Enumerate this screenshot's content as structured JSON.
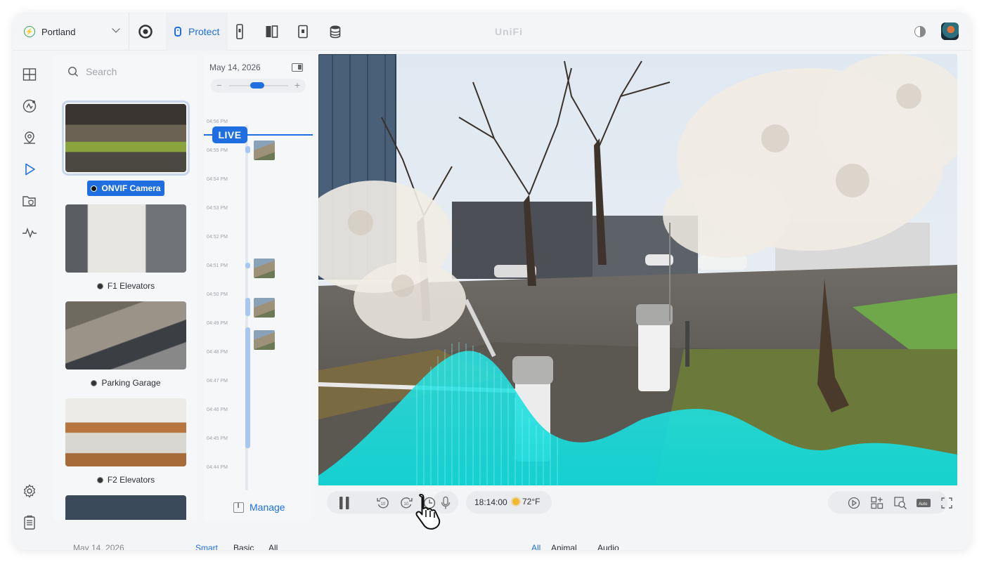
{
  "topbar": {
    "site_name": "Portland",
    "app_tab_label": "Protect",
    "brand": "UniFi",
    "apps": [
      "circle-app-icon",
      "protect-pin-icon",
      "access-device-icon",
      "panels-icon",
      "talk-device-icon",
      "storage-icon"
    ]
  },
  "nav": {
    "items": [
      "grid-view-icon",
      "ai-detect-icon",
      "map-pin-icon",
      "play-icon",
      "folder-shield-icon",
      "activity-icon"
    ],
    "bottom": [
      "settings-icon",
      "logs-icon"
    ],
    "active_index": 3
  },
  "search": {
    "placeholder": "Search"
  },
  "cameras": [
    {
      "label": "ONVIF Camera",
      "selected": true
    },
    {
      "label": "F1 Elevators",
      "selected": false
    },
    {
      "label": "Parking Garage",
      "selected": false
    },
    {
      "label": "F2 Elevators",
      "selected": false
    }
  ],
  "timeline": {
    "date": "May 14, 2026",
    "live_label": "LIVE",
    "ticks": [
      "04:56 PM",
      "04:55 PM",
      "04:54 PM",
      "04:53 PM",
      "04:52 PM",
      "04:51 PM",
      "04:50 PM",
      "04:49 PM",
      "04:48 PM",
      "04:47 PM",
      "04:46 PM",
      "04:45 PM",
      "04:44 PM"
    ],
    "manage_label": "Manage"
  },
  "player": {
    "time": "18:14:00",
    "temperature": "72°F",
    "skip_back": "10",
    "skip_forward": "10",
    "quality_label": "Auto"
  },
  "bottombar": {
    "date": "May 14, 2026",
    "filters_a": [
      "Smart",
      "Basic",
      "All"
    ],
    "filters_b": [
      "All",
      "Animal",
      "Audio"
    ]
  },
  "colors": {
    "accent": "#1f6fe0",
    "audio_wave": "#1ee0e0",
    "background": "#f4f5f7"
  }
}
